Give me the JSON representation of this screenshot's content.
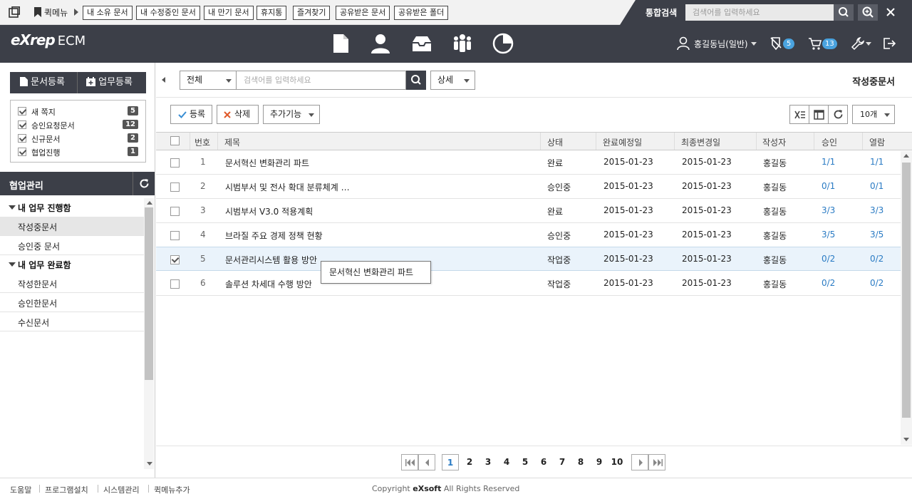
{
  "quickbar": {
    "label": "퀵메뉴",
    "buttons": [
      "내 소유 문서",
      "내 수정중인 문서",
      "내 만기 문서",
      "휴지통",
      "즐겨찾기",
      "공유받은 문서",
      "공유받은 폴더"
    ]
  },
  "global_search": {
    "title": "통합검색",
    "placeholder": "검색어를 입력하세요"
  },
  "header": {
    "logo": "eXrep",
    "logo_suffix": "ECM",
    "nav_icons": [
      "document-icon",
      "user-icon",
      "inbox-icon",
      "team-icon",
      "pie-chart-icon"
    ],
    "user_name": "홍길동님(일반)",
    "approval_count": "5",
    "cart_count": "13"
  },
  "sidebar": {
    "register_doc": "문서등록",
    "register_task": "업무등록",
    "notices": [
      {
        "label": "새 쪽지",
        "count": "5"
      },
      {
        "label": "승인요청문서",
        "count": "12"
      },
      {
        "label": "신규문서",
        "count": "2"
      },
      {
        "label": "협업진행",
        "count": "1"
      }
    ],
    "section_title": "협업관리",
    "groups": [
      {
        "title": "내 업무 진행함",
        "items": [
          "작성중문서",
          "승인중 문서"
        ]
      },
      {
        "title": "내 업무 완료함",
        "items": [
          "작성한문서",
          "승인한문서",
          "수신문서"
        ]
      }
    ]
  },
  "search": {
    "scope": "전체",
    "placeholder": "검색어를 입력하세요",
    "detail": "상세"
  },
  "page_title": "작성중문서",
  "toolbar": {
    "register": "등록",
    "delete": "삭제",
    "more": "추가기능",
    "page_size": "10개"
  },
  "table": {
    "columns": [
      "번호",
      "제목",
      "상태",
      "완료예정일",
      "최종변경일",
      "작성자",
      "승인",
      "열람"
    ],
    "rows": [
      {
        "no": "1",
        "title": "문서혁신 변화관리 파트",
        "status": "완료",
        "due": "2015-01-23",
        "modified": "2015-01-23",
        "author": "홍길동",
        "approve": "1/1",
        "read": "1/1",
        "checked": false
      },
      {
        "no": "2",
        "title": "시범부서 및 전사 확대 분류체계 …",
        "status": "승인중",
        "due": "2015-01-23",
        "modified": "2015-01-23",
        "author": "홍길동",
        "approve": "0/1",
        "read": "0/1",
        "checked": false
      },
      {
        "no": "3",
        "title": "시범부서 V3.0 적용계획",
        "status": "완료",
        "due": "2015-01-23",
        "modified": "2015-01-23",
        "author": "홍길동",
        "approve": "3/3",
        "read": "3/3",
        "checked": false
      },
      {
        "no": "4",
        "title": "브라질 주요 경제 정책 현황",
        "status": "승인중",
        "due": "2015-01-23",
        "modified": "2015-01-23",
        "author": "홍길동",
        "approve": "3/5",
        "read": "3/5",
        "checked": false
      },
      {
        "no": "5",
        "title": "문서관리시스템 활용 방안",
        "status": "작업중",
        "due": "2015-01-23",
        "modified": "2015-01-23",
        "author": "홍길동",
        "approve": "0/2",
        "read": "0/2",
        "checked": true
      },
      {
        "no": "6",
        "title": "솔루션 차세대 수행 방안",
        "status": "작업중",
        "due": "2015-01-23",
        "modified": "2015-01-23",
        "author": "홍길동",
        "approve": "0/2",
        "read": "0/2",
        "checked": false
      }
    ]
  },
  "tooltip": "문서혁신 변화관리 파트",
  "pagination": {
    "pages": [
      "1",
      "2",
      "3",
      "4",
      "5",
      "6",
      "7",
      "8",
      "9",
      "10"
    ],
    "current": "1"
  },
  "footer": {
    "links": [
      "도움말",
      "프로그램설치",
      "시스템관리",
      "퀵메뉴추가"
    ],
    "copyright_prefix": "Copyright",
    "brand": "eXsoft",
    "copyright_suffix": "All Rights Reserved"
  },
  "colors": {
    "dark": "#3c3f48",
    "link": "#2a7bc4",
    "badge": "#4aa3df",
    "selected_row": "#eaf3fb"
  }
}
